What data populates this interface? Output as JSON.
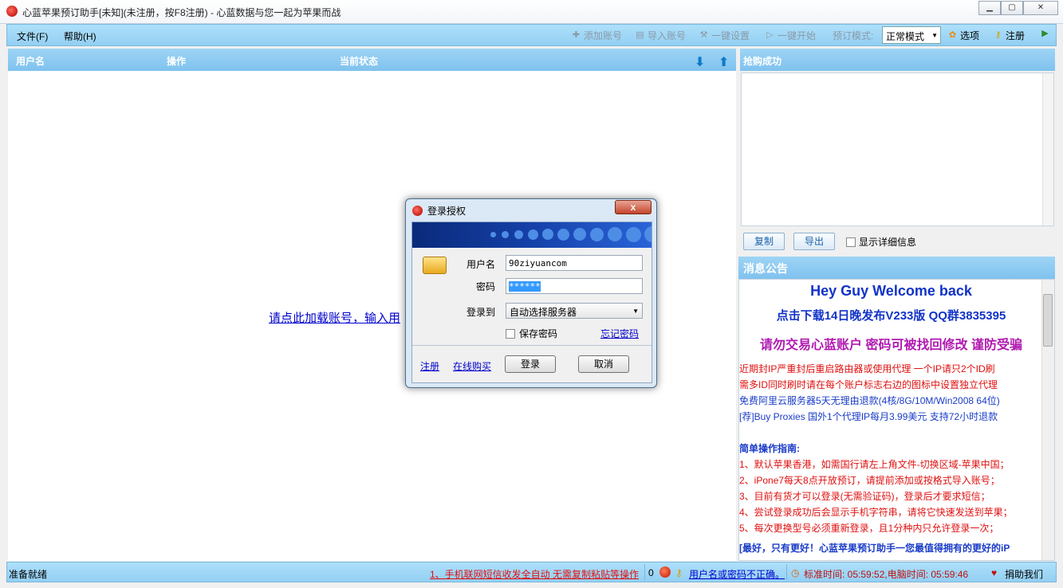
{
  "window": {
    "title": "心蓝苹果预订助手[未知](未注册，按F8注册) - 心蓝数据与您一起为苹果而战"
  },
  "menu": {
    "file": "文件(F)",
    "help": "帮助(H)"
  },
  "toolbar": {
    "add_account": "添加账号",
    "import_account": "导入账号",
    "one_click_settings": "一键设置",
    "one_click_start": "一键开始",
    "booking_mode_label": "预订模式:",
    "booking_mode_value": "正常模式",
    "options": "选项",
    "register": "注册"
  },
  "account_table": {
    "col_username": "用户名",
    "col_action": "操作",
    "col_status": "当前状态",
    "load_hint": "请点此加载账号，输入用"
  },
  "success_panel": {
    "title": "抢购成功",
    "copy": "复制",
    "export": "导出",
    "show_details": "显示详细信息"
  },
  "notice": {
    "title": "消息公告",
    "hey": "Hey Guy Welcome back",
    "download": "点击下载14日晚发布V233版  QQ群3835395",
    "warning": "请勿交易心蓝账户  密码可被找回修改  谨防受骗",
    "lines": [
      {
        "text": "近期封IP严重封后重启路由器或使用代理  一个IP请只2个ID刷",
        "color": "red"
      },
      {
        "text": "需多ID同时刷时请在每个账户标志右边的图标中设置独立代理",
        "color": "red"
      },
      {
        "text": "免费阿里云服务器5天无理由退款(4核/8G/10M/Win2008 64位)",
        "color": "blue"
      },
      {
        "text": "[荐]Buy Proxies 国外1个代理IP每月3.99美元  支持72小时退款",
        "color": "blue"
      }
    ],
    "guide_title": "简单操作指南:",
    "guide": [
      "1、默认苹果香港，如需国行请左上角文件-切换区域-苹果中国；",
      "2、iPone7每天8点开放预订，请提前添加或按格式导入账号；",
      "3、目前有货才可以登录(无需验证码)，登录后才要求短信；",
      "4、尝试登录成功后会显示手机字符串，请将它快速发送到苹果；",
      "5、每次更换型号必须重新登录，且1分种内只允许登录一次；"
    ],
    "marquee": "[最好，只有更好！心蓝苹果预订助手一您最值得拥有的更好的iP"
  },
  "status": {
    "ready": "准备就绪",
    "tip": "1、手机联网短信收发全自动 无需复制粘贴等操作",
    "count": "0",
    "login_error": "用户名或密码不正确。",
    "std_time": "标准时间: 05:59:52,电脑时间: 05:59:46",
    "donate": "捐助我们"
  },
  "login_dialog": {
    "title": "登录授权",
    "close": "x",
    "username_label": "用户名",
    "username_value": "90ziyuancom",
    "password_label": "密码",
    "password_value": "******",
    "server_label": "登录到",
    "server_value": "自动选择服务器",
    "save_password": "保存密码",
    "forgot_password": "忘记密码",
    "register_link": "注册",
    "buy_link": "在线购买",
    "login_button": "登录",
    "cancel_button": "取消"
  },
  "colors": {
    "header_blue": "#7fc2ee",
    "link_blue": "#0000cc",
    "notice_red": "#e01010",
    "notice_blue": "#1a3cc8"
  }
}
